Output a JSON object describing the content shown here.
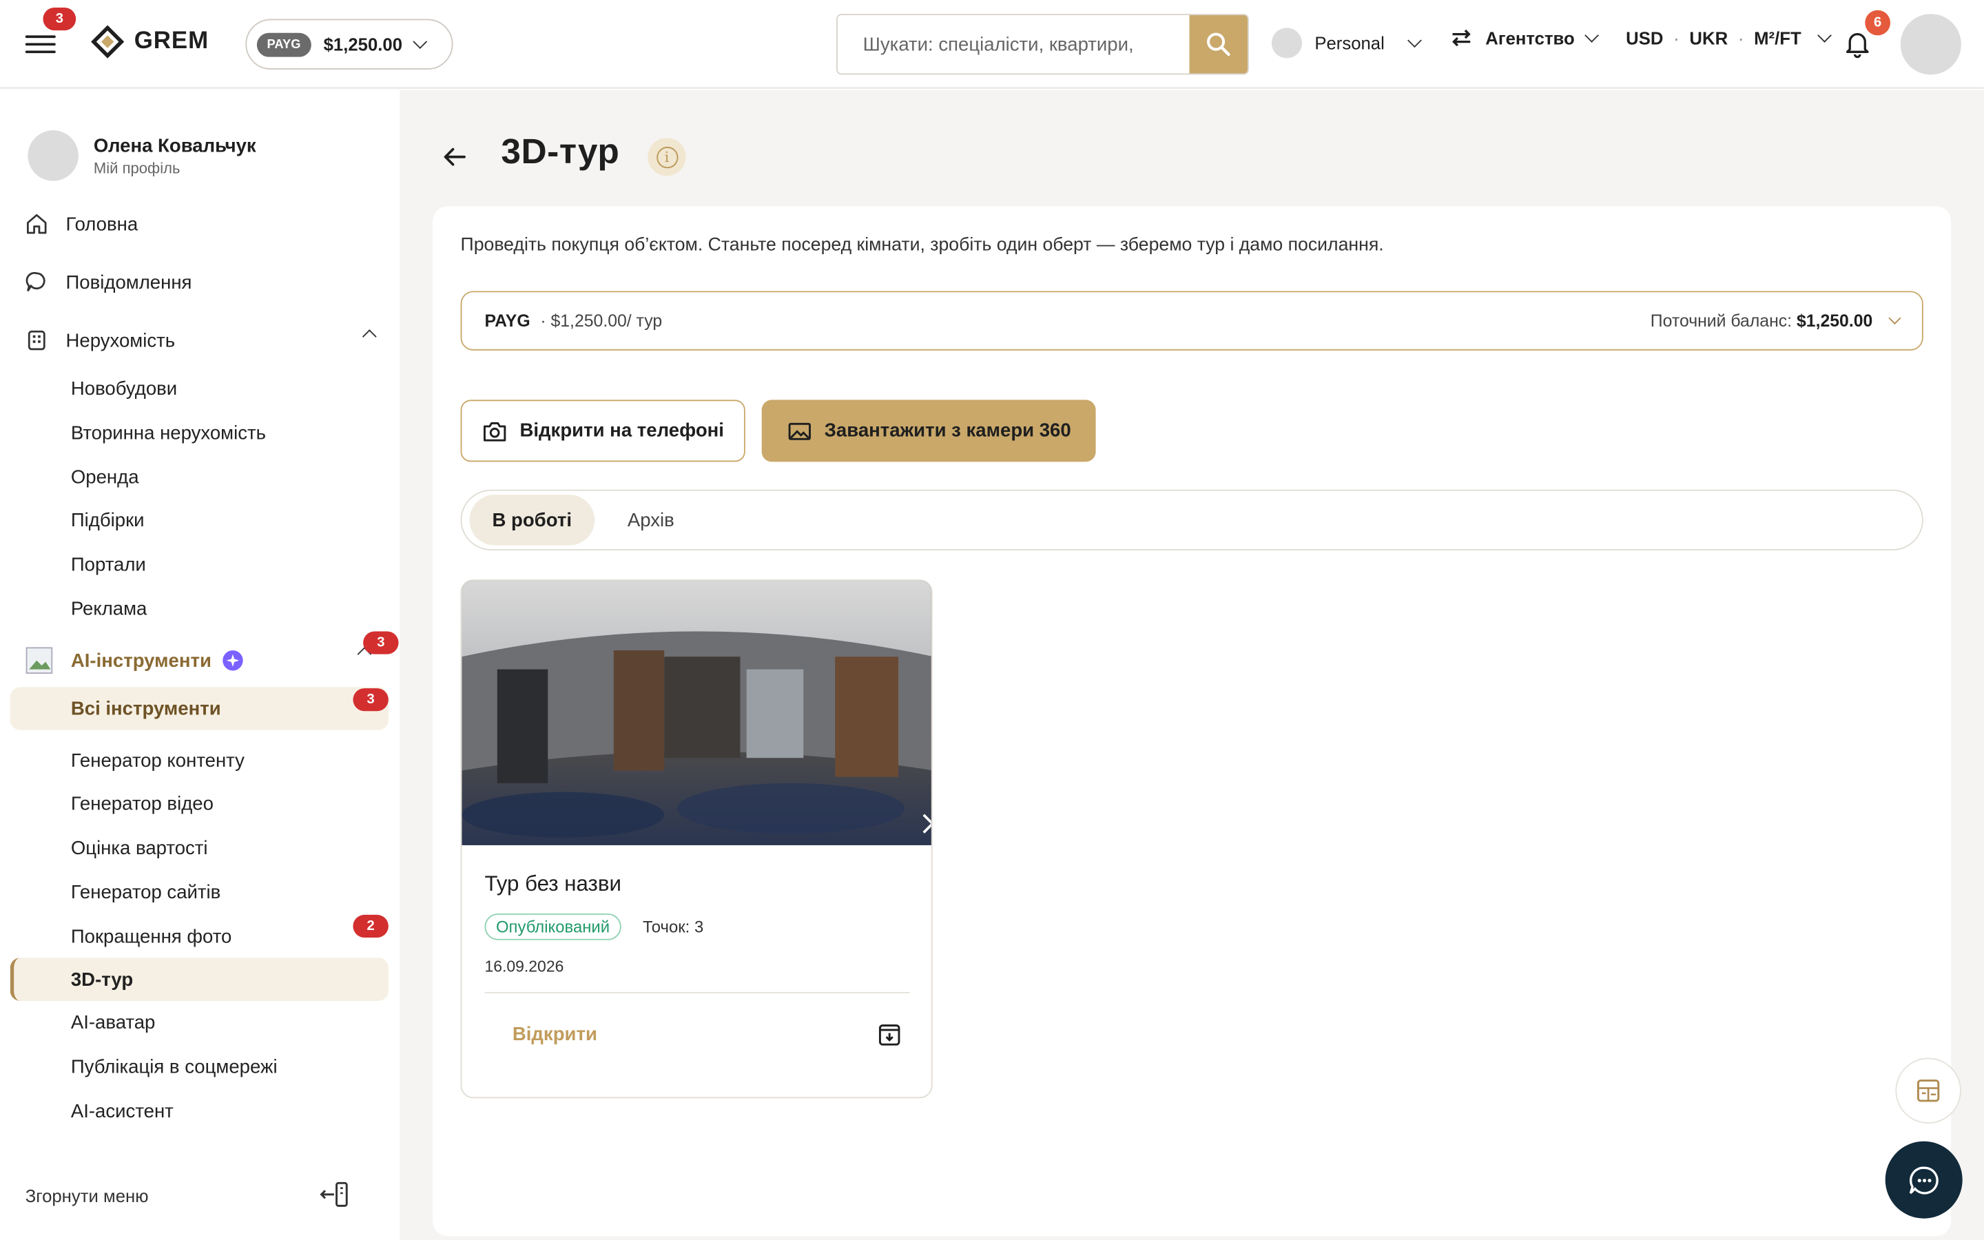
{
  "header": {
    "menu_badge": "3",
    "logo_text": "GREM",
    "plan_tag": "PAYG",
    "balance": "$1,250.00",
    "search_placeholder": "Шукати: спеціалісти, квартири,",
    "workspace": "Personal",
    "agency": "Агентство",
    "currency": "USD",
    "language": "UKR",
    "area_unit": "M²/FT",
    "notifications_count": "6"
  },
  "sidebar": {
    "profile_name": "Олена Ковальчук",
    "profile_sub": "Мій профіль",
    "main_items": [
      "Головна",
      "Повідомлення",
      "Нерухомість"
    ],
    "realty_items": [
      "Новобудови",
      "Вторинна нерухомість",
      "Оренда",
      "Підбірки",
      "Портали",
      "Реклама"
    ],
    "ai_section": {
      "label": "AI-інструменти",
      "badge": "3"
    },
    "ai_items": [
      {
        "label": "Всі інструменти",
        "badge": "3"
      },
      {
        "label": "Генератор контенту"
      },
      {
        "label": "Генератор відео"
      },
      {
        "label": "Оцінка вартості"
      },
      {
        "label": "Генератор сайтів"
      },
      {
        "label": "Покращення фото",
        "badge": "2"
      },
      {
        "label": "3D-тур"
      },
      {
        "label": "AI-аватар"
      },
      {
        "label": "Публікація в соцмережі"
      },
      {
        "label": "AI-асистент"
      }
    ],
    "collapse_label": "Згорнути меню"
  },
  "page": {
    "title": "3D-тур",
    "hint": "Проведіть покупця об’єктом. Станьте посеред кімнати, зробіть один оберт — зберемо тур і дамо посилання.",
    "plan": {
      "name": "PAYG",
      "rate": "· $1,250.00/ тур",
      "balance_label": "Поточний баланс:",
      "balance_value": "$1,250.00"
    },
    "buttons": {
      "open_phone": "Відкрити на телефоні",
      "upload_360": "Завантажити з камери 360"
    },
    "tabs": [
      "В роботі",
      "Архів"
    ],
    "card": {
      "title": "Тур без назви",
      "status": "Опублікований",
      "points": "Точок: 3",
      "date": "16.09.2026",
      "open_label": "Відкрити"
    }
  },
  "colors": {
    "accent_gold": "#c9a86a",
    "active_bg": "#f6f0e4",
    "badge_red": "#d32f2f",
    "chat_fab": "#122a3a",
    "status_green": "#22996b"
  }
}
